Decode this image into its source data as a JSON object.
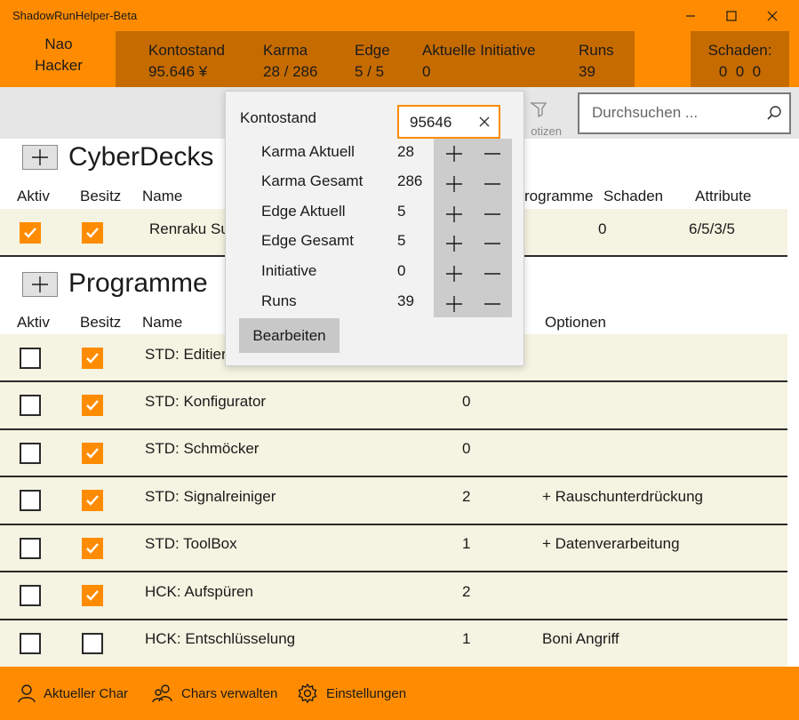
{
  "window": {
    "title": "ShadowRunHelper-Beta"
  },
  "character": {
    "line1": "Nao",
    "line2": "Hacker"
  },
  "stats": [
    {
      "label": "Kontostand",
      "value": "95.646 ¥"
    },
    {
      "label": "Karma",
      "value": "28 / 286"
    },
    {
      "label": "Edge",
      "value": "5 / 5"
    },
    {
      "label": "Aktuelle Initiative",
      "value": "0"
    },
    {
      "label": "Runs",
      "value": "39"
    }
  ],
  "damage": {
    "label": "Schaden:",
    "value": "0  0  0"
  },
  "toolbar": {
    "notes_label": "otizen",
    "search_placeholder": "Durchsuchen ..."
  },
  "cyberdecks": {
    "title": "CyberDecks",
    "headers": {
      "aktiv": "Aktiv",
      "besitz": "Besitz",
      "name": "Name",
      "programme": "rogramme",
      "schaden": "Schaden",
      "attribute": "Attribute"
    },
    "rows": [
      {
        "aktiv": true,
        "besitz": true,
        "name": "Renraku Su",
        "schaden": "0",
        "attribute": "6/5/3/5"
      }
    ]
  },
  "programme": {
    "title": "Programme",
    "headers": {
      "aktiv": "Aktiv",
      "besitz": "Besitz",
      "name": "Name",
      "optionen": "Optionen"
    },
    "rows": [
      {
        "aktiv": false,
        "besitz": true,
        "name": "STD: Editier",
        "value": "",
        "optionen": ""
      },
      {
        "aktiv": false,
        "besitz": true,
        "name": "STD: Konfigurator",
        "value": "0",
        "optionen": ""
      },
      {
        "aktiv": false,
        "besitz": true,
        "name": "STD: Schmöcker",
        "value": "0",
        "optionen": ""
      },
      {
        "aktiv": false,
        "besitz": true,
        "name": "STD: Signalreiniger",
        "value": "2",
        "optionen": "+ Rauschunterdrückung"
      },
      {
        "aktiv": false,
        "besitz": true,
        "name": "STD: ToolBox",
        "value": "1",
        "optionen": "+ Datenverarbeitung"
      },
      {
        "aktiv": false,
        "besitz": true,
        "name": "HCK: Aufspüren",
        "value": "2",
        "optionen": ""
      },
      {
        "aktiv": false,
        "besitz": false,
        "name": "HCK: Entschlüsselung",
        "value": "1",
        "optionen": "Boni Angriff"
      }
    ]
  },
  "popup": {
    "title": "Kontostand",
    "input_value": "95646",
    "rows": [
      {
        "label": "Karma Aktuell",
        "value": "28"
      },
      {
        "label": "Karma Gesamt",
        "value": "286"
      },
      {
        "label": "Edge Aktuell",
        "value": "5"
      },
      {
        "label": "Edge Gesamt",
        "value": "5"
      },
      {
        "label": "Initiative",
        "value": "0"
      },
      {
        "label": "Runs",
        "value": "39"
      }
    ],
    "edit_label": "Bearbeiten"
  },
  "nav": [
    {
      "label": "Aktueller Char",
      "icon": "person-icon"
    },
    {
      "label": "Chars verwalten",
      "icon": "people-icon"
    },
    {
      "label": "Einstellungen",
      "icon": "gear-icon"
    }
  ],
  "colors": {
    "accent": "#ff8c00",
    "accent_dark": "#c66b00",
    "row_bg": "#f5f3e1"
  }
}
